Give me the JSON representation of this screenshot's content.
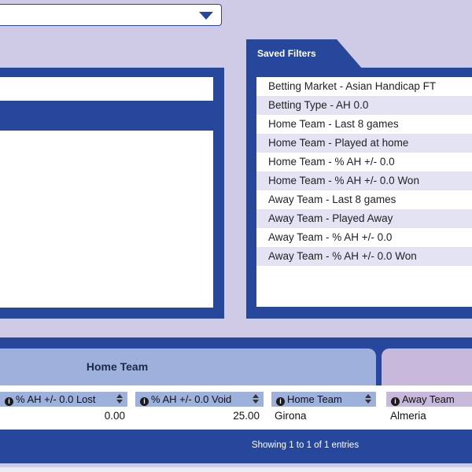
{
  "saved_filters": {
    "title": "Saved Filters",
    "items": [
      "Betting Market - Asian Handicap FT",
      "Betting Type - AH 0.0",
      "Home Team - Last 8 games",
      "Home Team - Played at home",
      "Home Team - % AH +/- 0.0",
      "Home Team - % AH +/- 0.0 Won",
      "Away Team - Last 8 games",
      "Away Team - Played Away",
      "Away Team - % AH +/- 0.0",
      "Away Team - % AH +/- 0.0 Won"
    ]
  },
  "table": {
    "group_headers": {
      "home": "Home Team",
      "away": ""
    },
    "columns": [
      "% AH +/- 0.0 Lost",
      "% AH +/- 0.0 Void",
      "Home Team",
      "Away Team"
    ],
    "row": {
      "lost": "0.00",
      "void": "25.00",
      "home_team": "Girona",
      "away_team": "Almeria"
    },
    "footer": "Showing 1 to 1 of 1 entries"
  },
  "colors": {
    "background": "#cfcbe6",
    "panel": "#26479b",
    "home_header": "#9eb0dc",
    "away_header": "#c8b8dc"
  },
  "icons": {
    "dropdown": "chevron-down-icon",
    "info": "info-icon",
    "sort": "sort-icon"
  }
}
